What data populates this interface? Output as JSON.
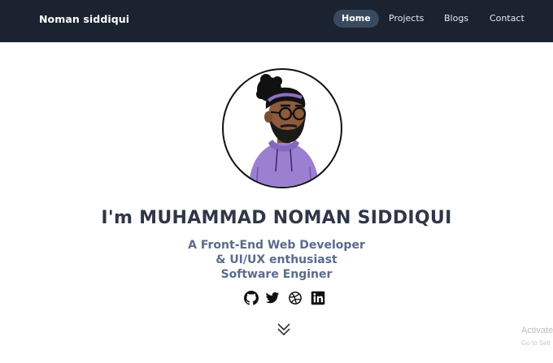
{
  "navbar": {
    "brand": "Noman siddiqui",
    "links": [
      {
        "label": "Home",
        "active": true
      },
      {
        "label": "Projects",
        "active": false
      },
      {
        "label": "Blogs",
        "active": false
      },
      {
        "label": "Contact",
        "active": false
      }
    ]
  },
  "hero": {
    "avatar_icon": "developer-avatar-illustration",
    "title": "I'm MUHAMMAD NOMAN SIDDIQUI",
    "tagline_lines": [
      "A Front-End Web Developer",
      "& UI/UX enthusiast",
      "Software Enginer"
    ],
    "socials": [
      {
        "icon": "github-icon"
      },
      {
        "icon": "twitter-icon"
      },
      {
        "icon": "dribbble-icon"
      },
      {
        "icon": "linkedin-icon"
      }
    ],
    "scroll_icon": "chevron-double-down-icon"
  },
  "watermark": {
    "line1": "Activate",
    "line2": "Go to Sett"
  },
  "colors": {
    "navbar_bg": "#1b2230",
    "active_pill": "#3a4a5e",
    "title_text": "#2f3747",
    "tagline_text": "#5a6b8c",
    "hoodie": "#9b7fd0"
  }
}
